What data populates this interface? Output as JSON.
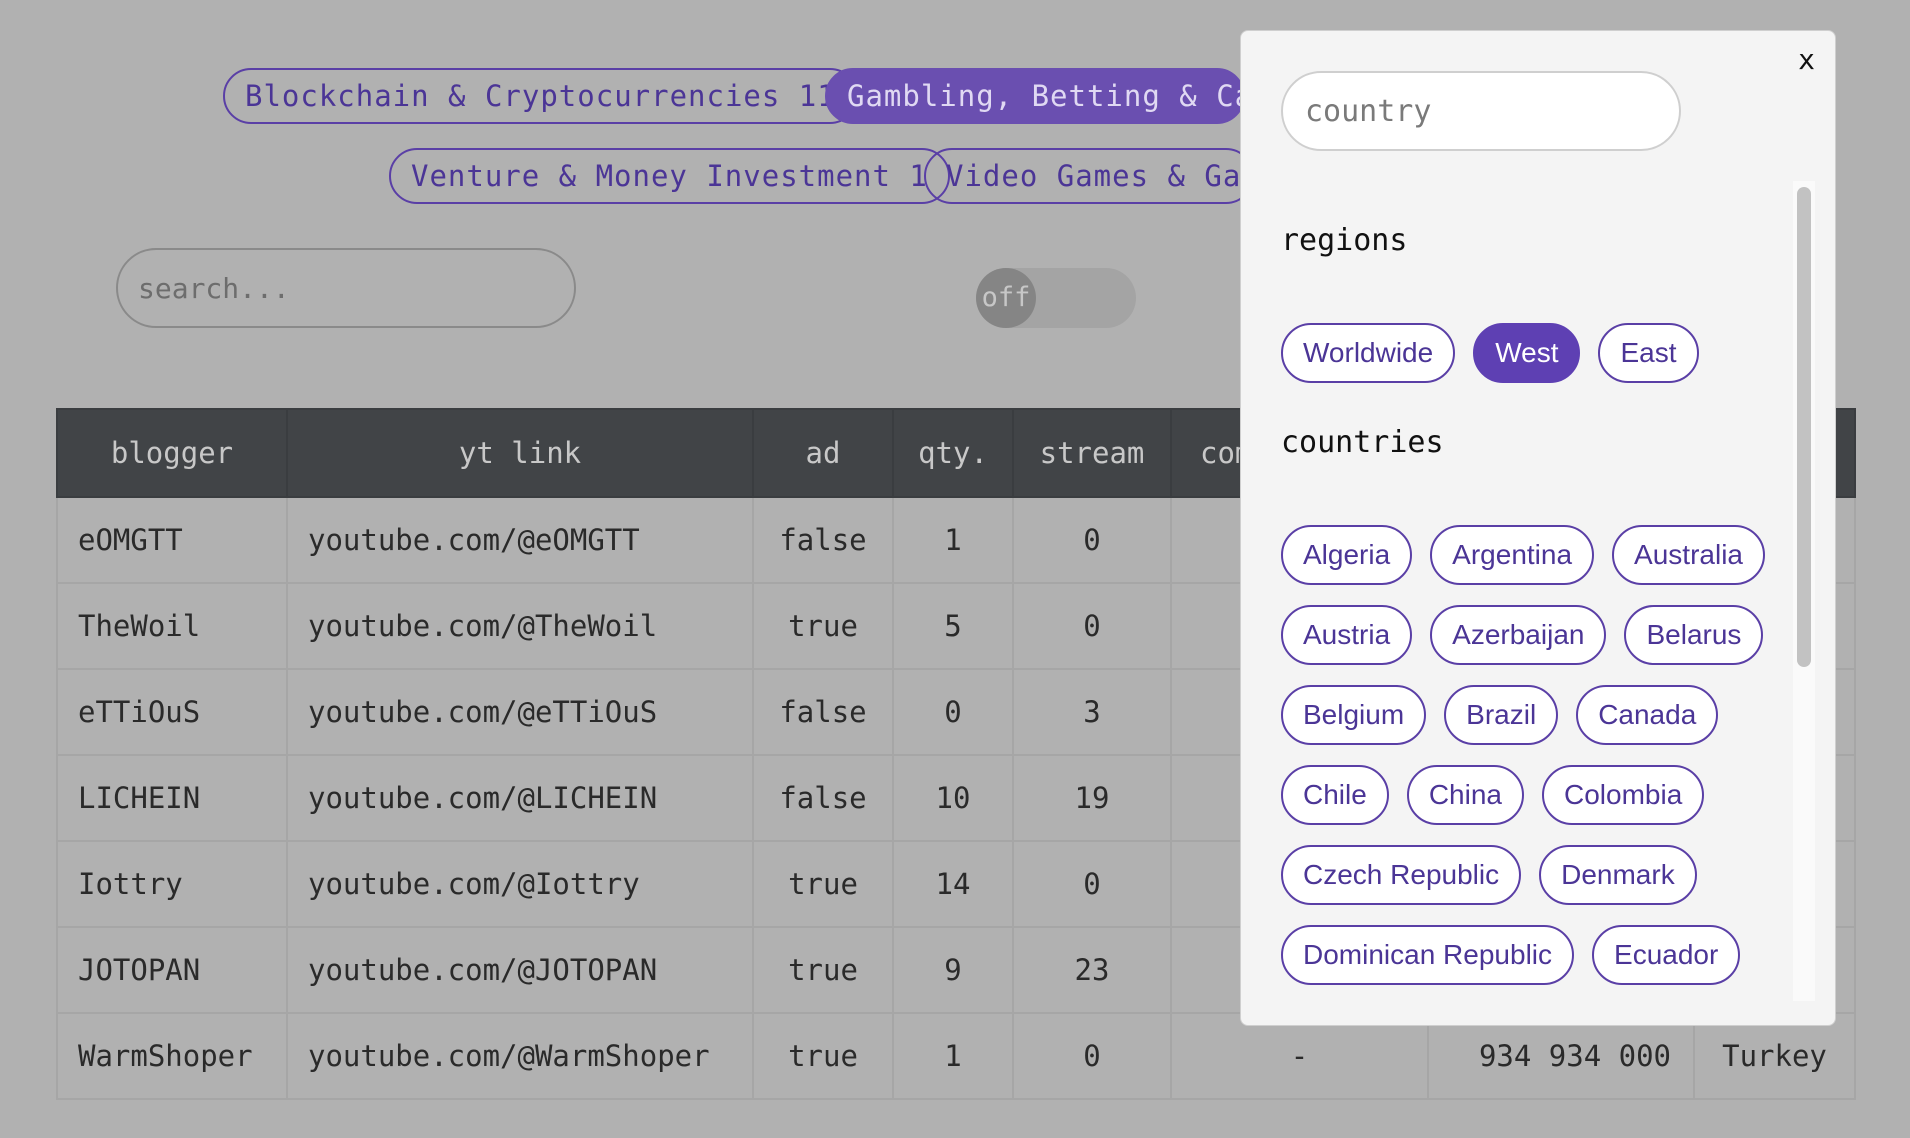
{
  "tags": [
    {
      "label": "Blockchain & Cryptocurrencies 11"
    },
    {
      "label": "Gambling, Betting & Cas"
    },
    {
      "label": "Venture & Money Investment 1"
    },
    {
      "label": "Video Games & Game"
    }
  ],
  "search": {
    "placeholder": "search..."
  },
  "toggle": {
    "label": "off"
  },
  "table": {
    "headers": [
      "blogger",
      "yt link",
      "ad",
      "qty.",
      "stream",
      "com"
    ],
    "rows": [
      [
        "eOMGTT",
        "youtube.com/@eOMGTT",
        "false",
        "1",
        "0"
      ],
      [
        "TheWoil",
        "youtube.com/@TheWoil",
        "true",
        "5",
        "0"
      ],
      [
        "eTTiOuS",
        "youtube.com/@eTTiOuS",
        "false",
        "0",
        "3"
      ],
      [
        "LICHEIN",
        "youtube.com/@LICHEIN",
        "false",
        "10",
        "19"
      ],
      [
        "Iottry",
        "youtube.com/@Iottry",
        "true",
        "14",
        "0"
      ],
      [
        "JOTOPAN",
        "youtube.com/@JOTOPAN",
        "true",
        "9",
        "23"
      ],
      [
        "WarmShoper",
        "youtube.com/@WarmShoper",
        "true",
        "1",
        "0",
        "-",
        "934 934 000",
        "Turkey"
      ]
    ]
  },
  "modal": {
    "close_label": "x",
    "input_placeholder": "country",
    "regions_title": "regions",
    "regions": [
      {
        "label": "Worldwide",
        "active": false
      },
      {
        "label": "West",
        "active": true
      },
      {
        "label": "East",
        "active": false
      }
    ],
    "countries_title": "countries",
    "countries": [
      "Algeria",
      "Argentina",
      "Australia",
      "Austria",
      "Azerbaijan",
      "Belarus",
      "Belgium",
      "Brazil",
      "Canada",
      "Chile",
      "China",
      "Colombia",
      "Czech Republic",
      "Denmark",
      "Dominican Republic",
      "Ecuador"
    ]
  },
  "colors": {
    "accent": "#5e40b3",
    "overlay": "#b1b1b1",
    "header": "#414447"
  }
}
